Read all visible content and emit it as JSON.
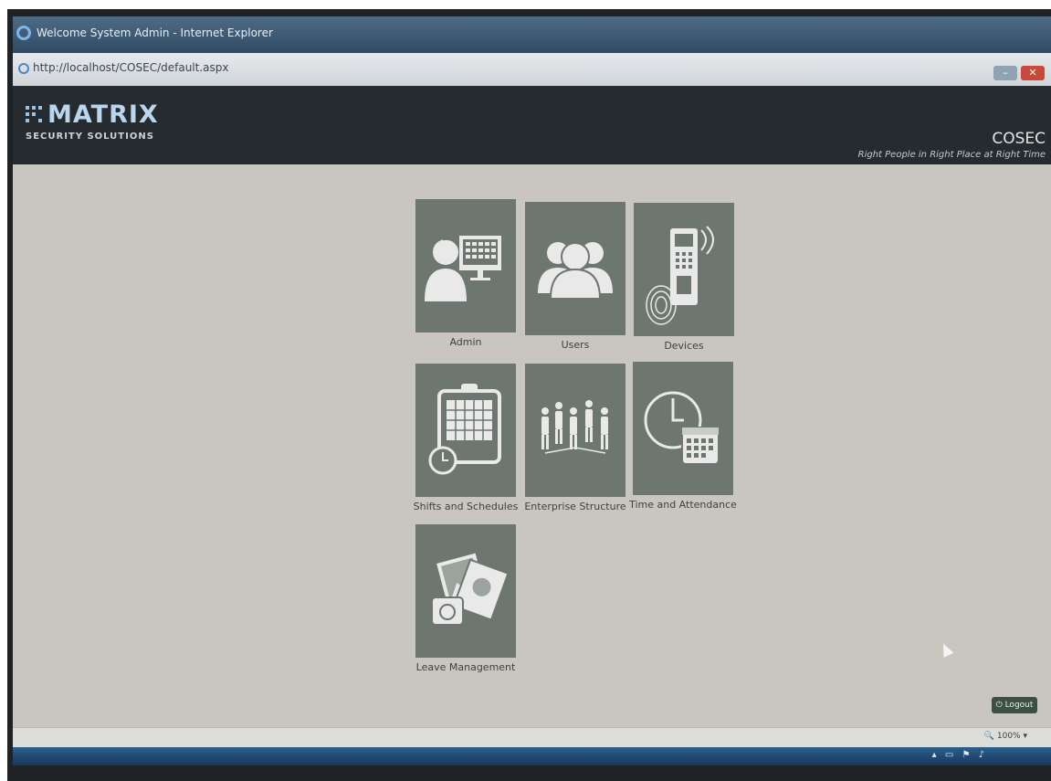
{
  "window": {
    "title": "Welcome System Admin - Internet Explorer",
    "address": "http://localhost/COSEC/default.aspx"
  },
  "brand": {
    "logo_name": "MATRIX",
    "logo_tagline": "SECURITY SOLUTIONS",
    "product": "COSEC",
    "product_tagline": "Right People in Right Place at Right Time"
  },
  "modules": [
    {
      "label": "Admin",
      "icon": "admin-icon"
    },
    {
      "label": "Users",
      "icon": "users-icon"
    },
    {
      "label": "Devices",
      "icon": "devices-icon"
    },
    {
      "label": "Shifts and Schedules",
      "icon": "calendar-clock-icon"
    },
    {
      "label": "Enterprise Structure",
      "icon": "org-people-icon"
    },
    {
      "label": "Time and Attendance",
      "icon": "clock-calendar-icon"
    },
    {
      "label": "Leave Management",
      "icon": "leave-photos-icon"
    }
  ],
  "footer": {
    "logout_label": "Logout",
    "zoom": "100%"
  },
  "colors": {
    "background": "#c9c6c0",
    "header": "#262b30",
    "tile": "#6d766f",
    "tile_icon": "#e9e9ea"
  }
}
